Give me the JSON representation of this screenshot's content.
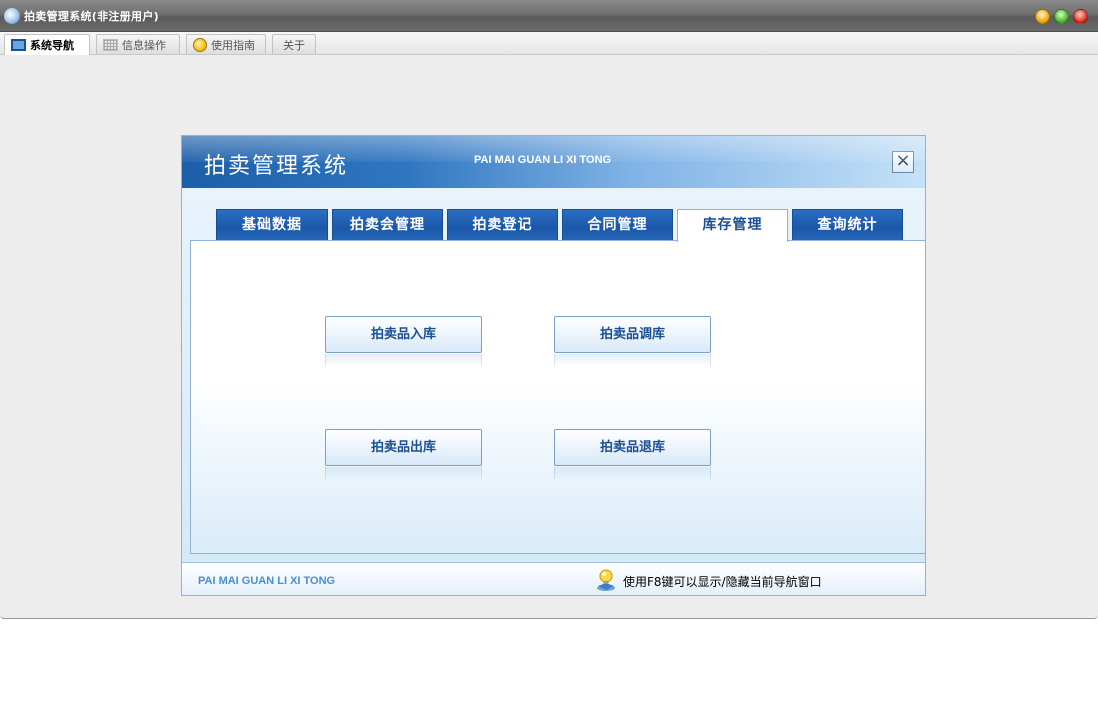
{
  "window": {
    "title": "拍卖管理系统(非注册用户)"
  },
  "menubar": {
    "tabs": [
      {
        "label": "系统导航",
        "icon": "screen-icon",
        "active": true
      },
      {
        "label": "信息操作",
        "icon": "grid-icon",
        "active": false
      },
      {
        "label": "使用指南",
        "icon": "guide-icon",
        "active": false
      },
      {
        "label": "关于",
        "icon": "",
        "active": false
      }
    ]
  },
  "panel": {
    "title": "拍卖管理系统",
    "subtitle": "PAI MAI GUAN LI XI TONG",
    "close_label": "×",
    "tabs": [
      {
        "label": "基础数据",
        "active": false
      },
      {
        "label": "拍卖会管理",
        "active": false
      },
      {
        "label": "拍卖登记",
        "active": false
      },
      {
        "label": "合同管理",
        "active": false
      },
      {
        "label": "库存管理",
        "active": true
      },
      {
        "label": "查询统计",
        "active": false
      }
    ],
    "buttons": [
      {
        "label": "拍卖品入库"
      },
      {
        "label": "拍卖品调库"
      },
      {
        "label": "拍卖品出库"
      },
      {
        "label": "拍卖品退库"
      }
    ],
    "footer": {
      "brand": "PAI MAI GUAN LI XI TONG",
      "tip": "使用F8键可以显示/隐藏当前导航窗口",
      "tip_icon": "lightbulb-icon"
    }
  },
  "colors": {
    "accent": "#1b57a8",
    "tab_text_active": "#1b4f94",
    "footer_brand": "#4b8ed0"
  }
}
